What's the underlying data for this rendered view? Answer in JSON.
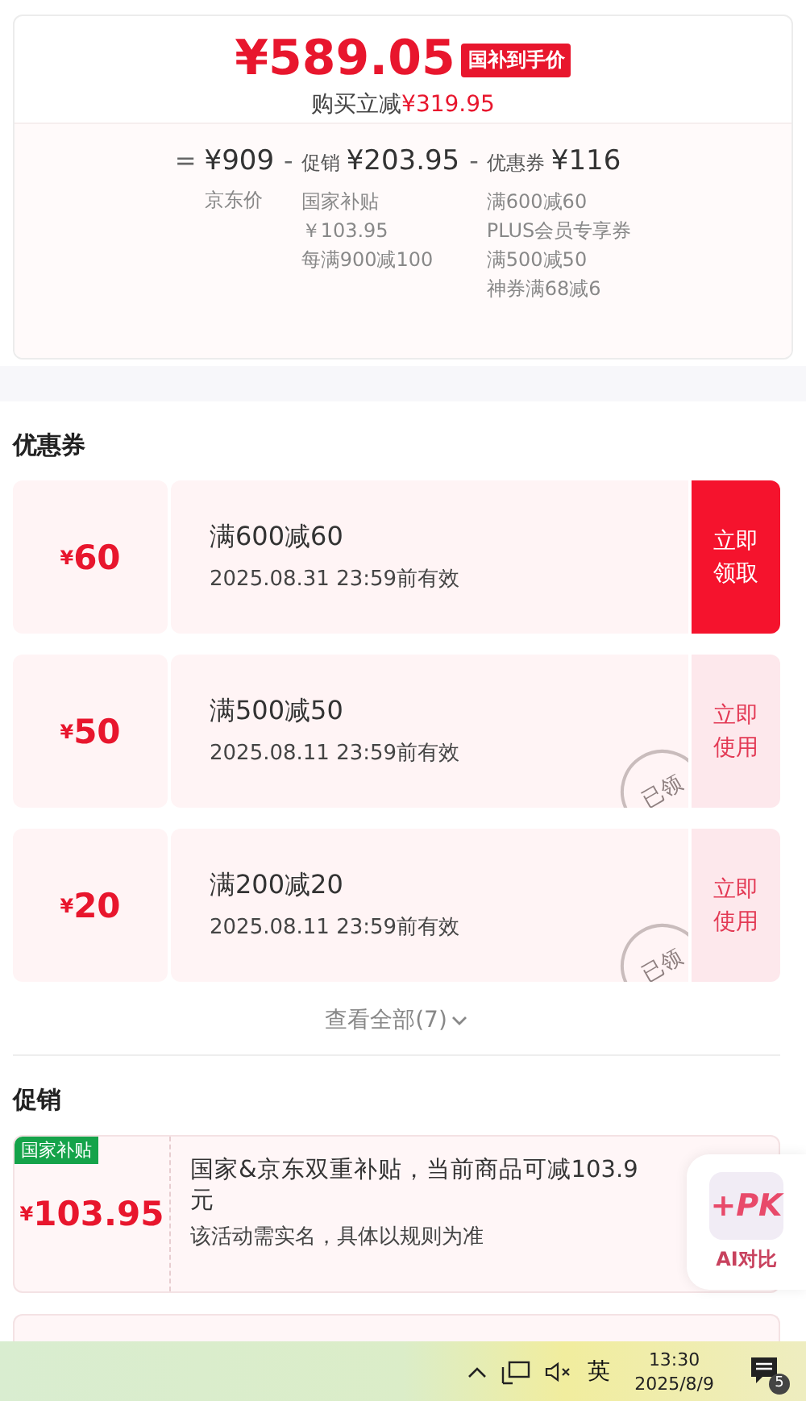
{
  "price_card": {
    "price": "¥589.05",
    "price_badge": "国补到手价",
    "saving_label": "购买立减",
    "saving_amount": "¥319.95",
    "breakdown": [
      {
        "operator": "=",
        "amount": "¥909",
        "details": [
          "京东价"
        ]
      },
      {
        "operator": "-",
        "label": "促销",
        "amount": "¥203.95",
        "details": [
          "国家补贴",
          "￥103.95",
          "每满900减100"
        ]
      },
      {
        "operator": "-",
        "label": "优惠券",
        "amount": "¥116",
        "details": [
          "满600减60",
          "PLUS会员专享券",
          "满500减50",
          "神券满68减6"
        ]
      }
    ]
  },
  "coupons": {
    "title": "优惠券",
    "items": [
      {
        "amount": "¥60",
        "condition": "满600减60",
        "validity": "2025.08.31 23:59前有效",
        "button": [
          "立即",
          "领取"
        ],
        "claimed": false
      },
      {
        "amount": "¥50",
        "condition": "满500减50",
        "validity": "2025.08.11 23:59前有效",
        "button": [
          "立即",
          "使用"
        ],
        "claimed": true,
        "stamp": "已领"
      },
      {
        "amount": "¥20",
        "condition": "满200减20",
        "validity": "2025.08.11 23:59前有效",
        "button": [
          "立即",
          "使用"
        ],
        "claimed": true,
        "stamp": "已领"
      }
    ],
    "view_all": "查看全部(7)"
  },
  "promotions": {
    "title": "促销",
    "items": [
      {
        "tag": "国家补贴",
        "amount": "¥103.95",
        "lines": [
          "国家&京东双重补贴，当前商品可减103.9",
          "元"
        ],
        "note": "该活动需实名，具体以规则为准"
      }
    ]
  },
  "ai_widget": {
    "logo": "+PK",
    "label": "AI对比"
  },
  "taskbar": {
    "ime": "英",
    "time": "13:30",
    "date": "2025/8/9",
    "notifications": "5"
  }
}
